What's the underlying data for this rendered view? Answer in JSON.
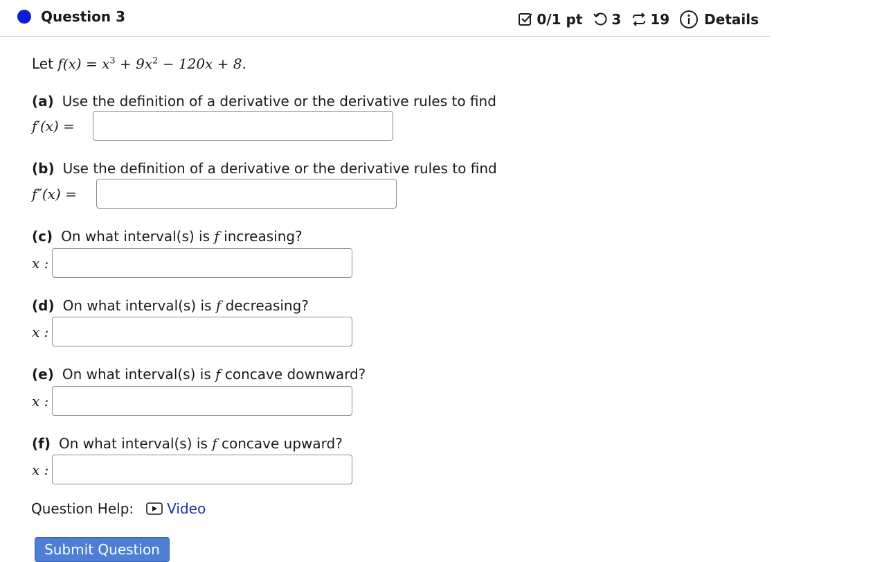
{
  "header": {
    "question_title": "Question 3",
    "score": "0/1 pt",
    "retries": "3",
    "submissions": "19",
    "details_label": "Details",
    "accent_color": "#0b1fd1"
  },
  "stem": {
    "prefix": "Let ",
    "function_lhs": "f(x) = ",
    "term1": "x",
    "exp1": "3",
    "term2": " + 9x",
    "exp2": "2",
    "term3": " − 120x + 8."
  },
  "parts": [
    {
      "tag": "(a)",
      "question": "Use the definition of a derivative or the derivative rules to find",
      "answer_label": "f′(x) =",
      "value": ""
    },
    {
      "tag": "(b)",
      "question": "Use the definition of a derivative or the derivative rules to find",
      "answer_label": "f″(x) =",
      "value": ""
    },
    {
      "tag": "(c)",
      "question_pre": "On what interval(s) is ",
      "fn": "f",
      "question_post": " increasing?",
      "answer_label": "x :",
      "value": ""
    },
    {
      "tag": "(d)",
      "question_pre": "On what interval(s) is ",
      "fn": "f",
      "question_post": " decreasing?",
      "answer_label": "x :",
      "value": ""
    },
    {
      "tag": "(e)",
      "question_pre": "On what interval(s) is ",
      "fn": "f",
      "question_post": " concave downward?",
      "answer_label": "x :",
      "value": ""
    },
    {
      "tag": "(f)",
      "question_pre": "On what interval(s) is ",
      "fn": "f",
      "question_post": " concave upward?",
      "answer_label": "x :",
      "value": ""
    }
  ],
  "help": {
    "label": "Question Help:",
    "video_label": "Video",
    "video_icon": "video-play-icon"
  },
  "submit_label": "Submit Question",
  "icons": {
    "score": "checkbox-icon",
    "retries": "retry-icon",
    "submissions": "submissions-icon",
    "details": "info-icon"
  }
}
